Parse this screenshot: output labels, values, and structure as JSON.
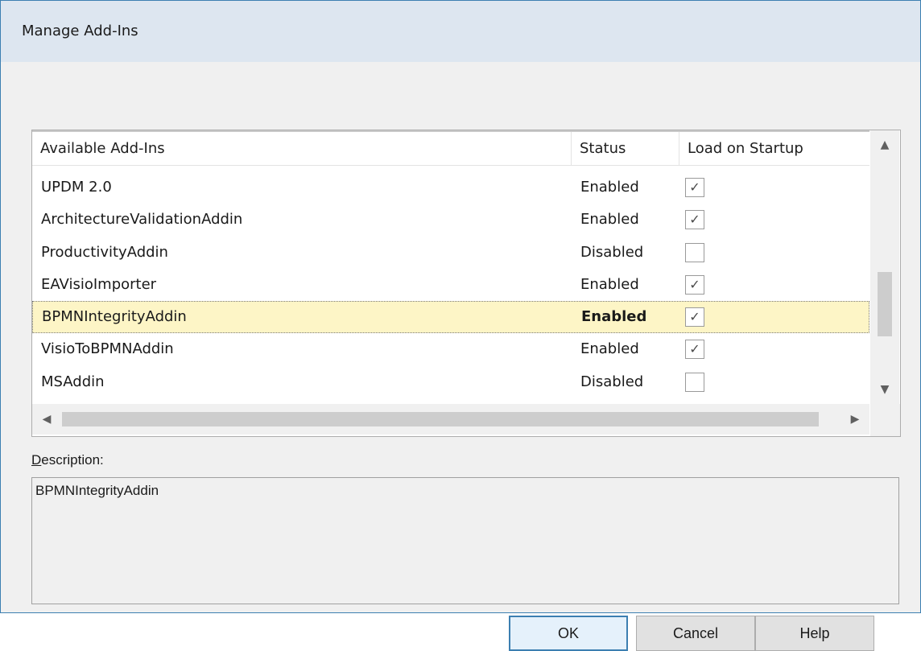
{
  "window": {
    "title": "Manage Add-Ins"
  },
  "listview": {
    "columns": [
      "Available Add-Ins",
      "Status",
      "Load on Startup"
    ],
    "rows": [
      {
        "name": "UPDM 2.0",
        "status": "Enabled",
        "load_on_startup": true
      },
      {
        "name": "ArchitectureValidationAddin",
        "status": "Enabled",
        "load_on_startup": true
      },
      {
        "name": "ProductivityAddin",
        "status": "Disabled",
        "load_on_startup": false
      },
      {
        "name": "EAVisioImporter",
        "status": "Enabled",
        "load_on_startup": true
      },
      {
        "name": "BPMNIntegrityAddin",
        "status": "Enabled",
        "load_on_startup": true,
        "selected": true
      },
      {
        "name": "VisioToBPMNAddin",
        "status": "Enabled",
        "load_on_startup": true
      },
      {
        "name": "MSAddin",
        "status": "Disabled",
        "load_on_startup": false
      }
    ]
  },
  "description": {
    "label": "Description:",
    "text": "BPMNIntegrityAddin"
  },
  "buttons": {
    "ok": "OK",
    "cancel": "Cancel",
    "help": "Help"
  },
  "icons": {
    "scroll_up": "triangle-up-icon",
    "scroll_down": "triangle-down-icon",
    "scroll_left": "triangle-left-icon",
    "scroll_right": "triangle-right-icon",
    "checkmark": "checkmark-icon"
  },
  "colors": {
    "title_bar": "#dde6f0",
    "selected_row": "#fdf5c6",
    "dialog_border": "#3c7fb1"
  }
}
